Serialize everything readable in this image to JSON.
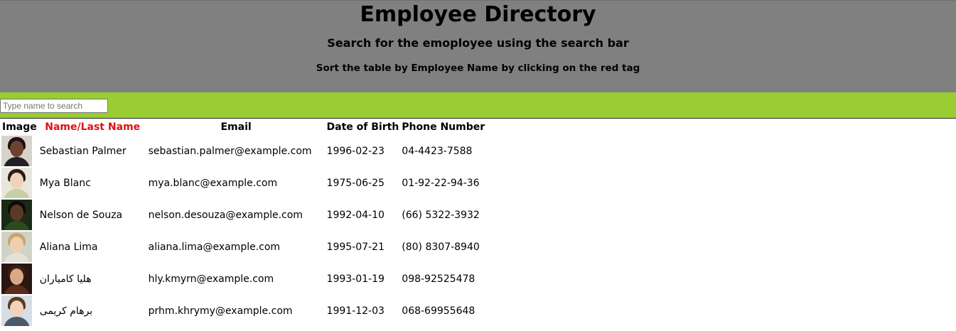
{
  "header": {
    "title": "Employee Directory",
    "subtitle": "Search for the emoployee using the search bar",
    "instructions": "Sort the table by Employee Name by clicking on the red tag"
  },
  "search": {
    "placeholder": "Type name to search",
    "value": ""
  },
  "table": {
    "columns": {
      "image": "Image",
      "name": "Name/Last Name",
      "email": "Email",
      "dob": "Date of Birth",
      "phone": "Phone Number"
    },
    "rows": [
      {
        "name": "Sebastian Palmer",
        "email": "sebastian.palmer@example.com",
        "dob": "1996-02-23",
        "phone": "04-4423-7588",
        "avatar": {
          "bg": "#d8d2cc",
          "skin": "#6b4330",
          "hair": "#1c130f",
          "shirt": "#222222"
        }
      },
      {
        "name": "Mya Blanc",
        "email": "mya.blanc@example.com",
        "dob": "1975-06-25",
        "phone": "01-92-22-94-36",
        "avatar": {
          "bg": "#e9e6dc",
          "skin": "#f0d2b8",
          "hair": "#2e1d15",
          "shirt": "#c7cfa8"
        }
      },
      {
        "name": "Nelson de Souza",
        "email": "nelson.desouza@example.com",
        "dob": "1992-04-10",
        "phone": "(66) 5322-3932",
        "avatar": {
          "bg": "#1a2a14",
          "skin": "#5a3a24",
          "hair": "#0d0a08",
          "shirt": "#2d4a1f"
        }
      },
      {
        "name": "Aliana Lima",
        "email": "aliana.lima@example.com",
        "dob": "1995-07-21",
        "phone": "(80) 8307-8940",
        "avatar": {
          "bg": "#cfd3c7",
          "skin": "#efcfae",
          "hair": "#c9a56a",
          "shirt": "#e6e1d6"
        }
      },
      {
        "name": "هلیا کامیاران",
        "email": "hly.kmyrn@example.com",
        "dob": "1993-01-19",
        "phone": "098-92525478",
        "avatar": {
          "bg": "#2a1510",
          "skin": "#d9a985",
          "hair": "#3b1d12",
          "shirt": "#5a2a1c"
        }
      },
      {
        "name": "برهام کریمی",
        "email": "prhm.khrymy@example.com",
        "dob": "1991-12-03",
        "phone": "068-69955648",
        "avatar": {
          "bg": "#d7dde4",
          "skin": "#f1d3bc",
          "hair": "#5b3a22",
          "shirt": "#4b5a6a"
        }
      }
    ]
  }
}
